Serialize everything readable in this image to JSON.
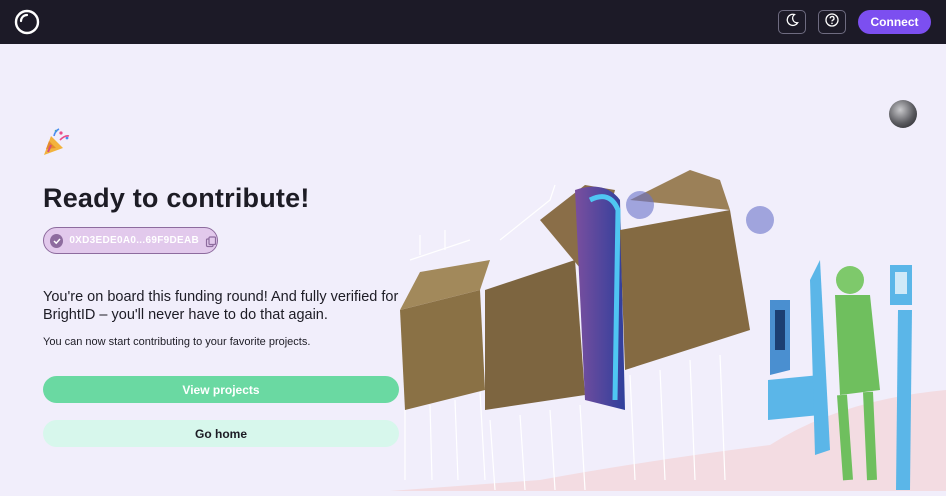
{
  "header": {
    "connect_label": "Connect",
    "icons": [
      "logo-ring-icon",
      "moon-icon",
      "help-icon"
    ]
  },
  "main": {
    "title": "Ready to contribute!",
    "address": "0XD3EDE0A0...69F9DEAB",
    "lead": "You're on board this funding round! And fully verified for BrightID – you'll never have to do that again.",
    "sub": "You can now start contributing to your favorite projects.",
    "primary_button": "View projects",
    "secondary_button": "Go home"
  },
  "colors": {
    "topbar": "#1c1a27",
    "accent": "#7c4ff0",
    "primary_button": "#6ad9a2",
    "secondary_button": "#d7f7ec",
    "background": "#f1eefb"
  }
}
